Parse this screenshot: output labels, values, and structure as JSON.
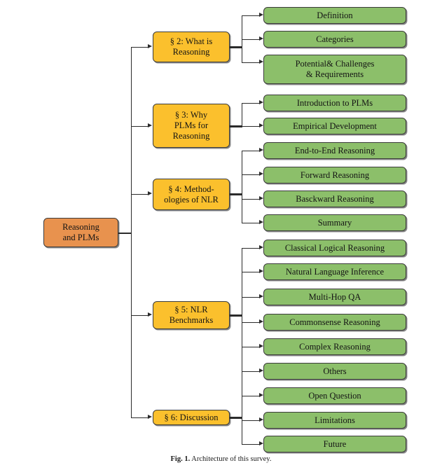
{
  "figure": {
    "caption_label": "Fig. 1.",
    "caption_text": "Architecture of this survey.",
    "caption_full": "Fig. 1.  Architecture of this survey."
  },
  "colors": {
    "root_fill": "#E8924E",
    "section_fill": "#FBC02D",
    "leaf_fill": "#8CBF6A",
    "stroke": "#3b3b3b",
    "connector": "#2b2b2b",
    "background": "#ffffff",
    "text": "#141414"
  },
  "diagram": {
    "type": "tree",
    "orientation": "left-to-right",
    "root": {
      "id": "root",
      "label": "Reasoning\nand PLMs",
      "line1": "Reasoning",
      "line2": "and PLMs"
    },
    "sections": [
      {
        "id": "sec2",
        "label": "§ 2: What is\nReasoning",
        "line1": "§ 2: What is",
        "line2": "Reasoning",
        "children": [
          {
            "id": "sec2-c1",
            "label": "Definition"
          },
          {
            "id": "sec2-c2",
            "label": "Categories"
          },
          {
            "id": "sec2-c3",
            "label": "Potential& Challenges\n& Requirements"
          }
        ]
      },
      {
        "id": "sec3",
        "label": "§ 3: Why\nPLMs for\nReasoning",
        "line1": "§ 3: Why",
        "line2": "PLMs for",
        "line3": "Reasoning",
        "children": [
          {
            "id": "sec3-c1",
            "label": "Introduction to PLMs"
          },
          {
            "id": "sec3-c2",
            "label": "Empirical Development"
          }
        ]
      },
      {
        "id": "sec4",
        "label": "§ 4: Method-\nologies of NLR",
        "line1": "§ 4: Method-",
        "line2": "ologies of NLR",
        "children": [
          {
            "id": "sec4-c1",
            "label": "End-to-End Reasoning"
          },
          {
            "id": "sec4-c2",
            "label": "Forward Reasoning"
          },
          {
            "id": "sec4-c3",
            "label": "Basckward Reasoning"
          },
          {
            "id": "sec4-c4",
            "label": "Summary"
          }
        ]
      },
      {
        "id": "sec5",
        "label": "§ 5: NLR\nBenchmarks",
        "line1": "§ 5: NLR",
        "line2": "Benchmarks",
        "children": [
          {
            "id": "sec5-c1",
            "label": "Classical Logical Reasoning"
          },
          {
            "id": "sec5-c2",
            "label": "Natural Language Inference"
          },
          {
            "id": "sec5-c3",
            "label": "Multi-Hop QA"
          },
          {
            "id": "sec5-c4",
            "label": "Commonsense Reasoning"
          },
          {
            "id": "sec5-c5",
            "label": "Complex Reasoning"
          },
          {
            "id": "sec5-c6",
            "label": "Others"
          }
        ]
      },
      {
        "id": "sec6",
        "label": "§ 6: Discussion",
        "line1": "§ 6: Discussion",
        "children": [
          {
            "id": "sec6-c1",
            "label": "Open Question"
          },
          {
            "id": "sec6-c2",
            "label": "Limitations"
          },
          {
            "id": "sec6-c3",
            "label": "Future"
          }
        ]
      }
    ]
  }
}
